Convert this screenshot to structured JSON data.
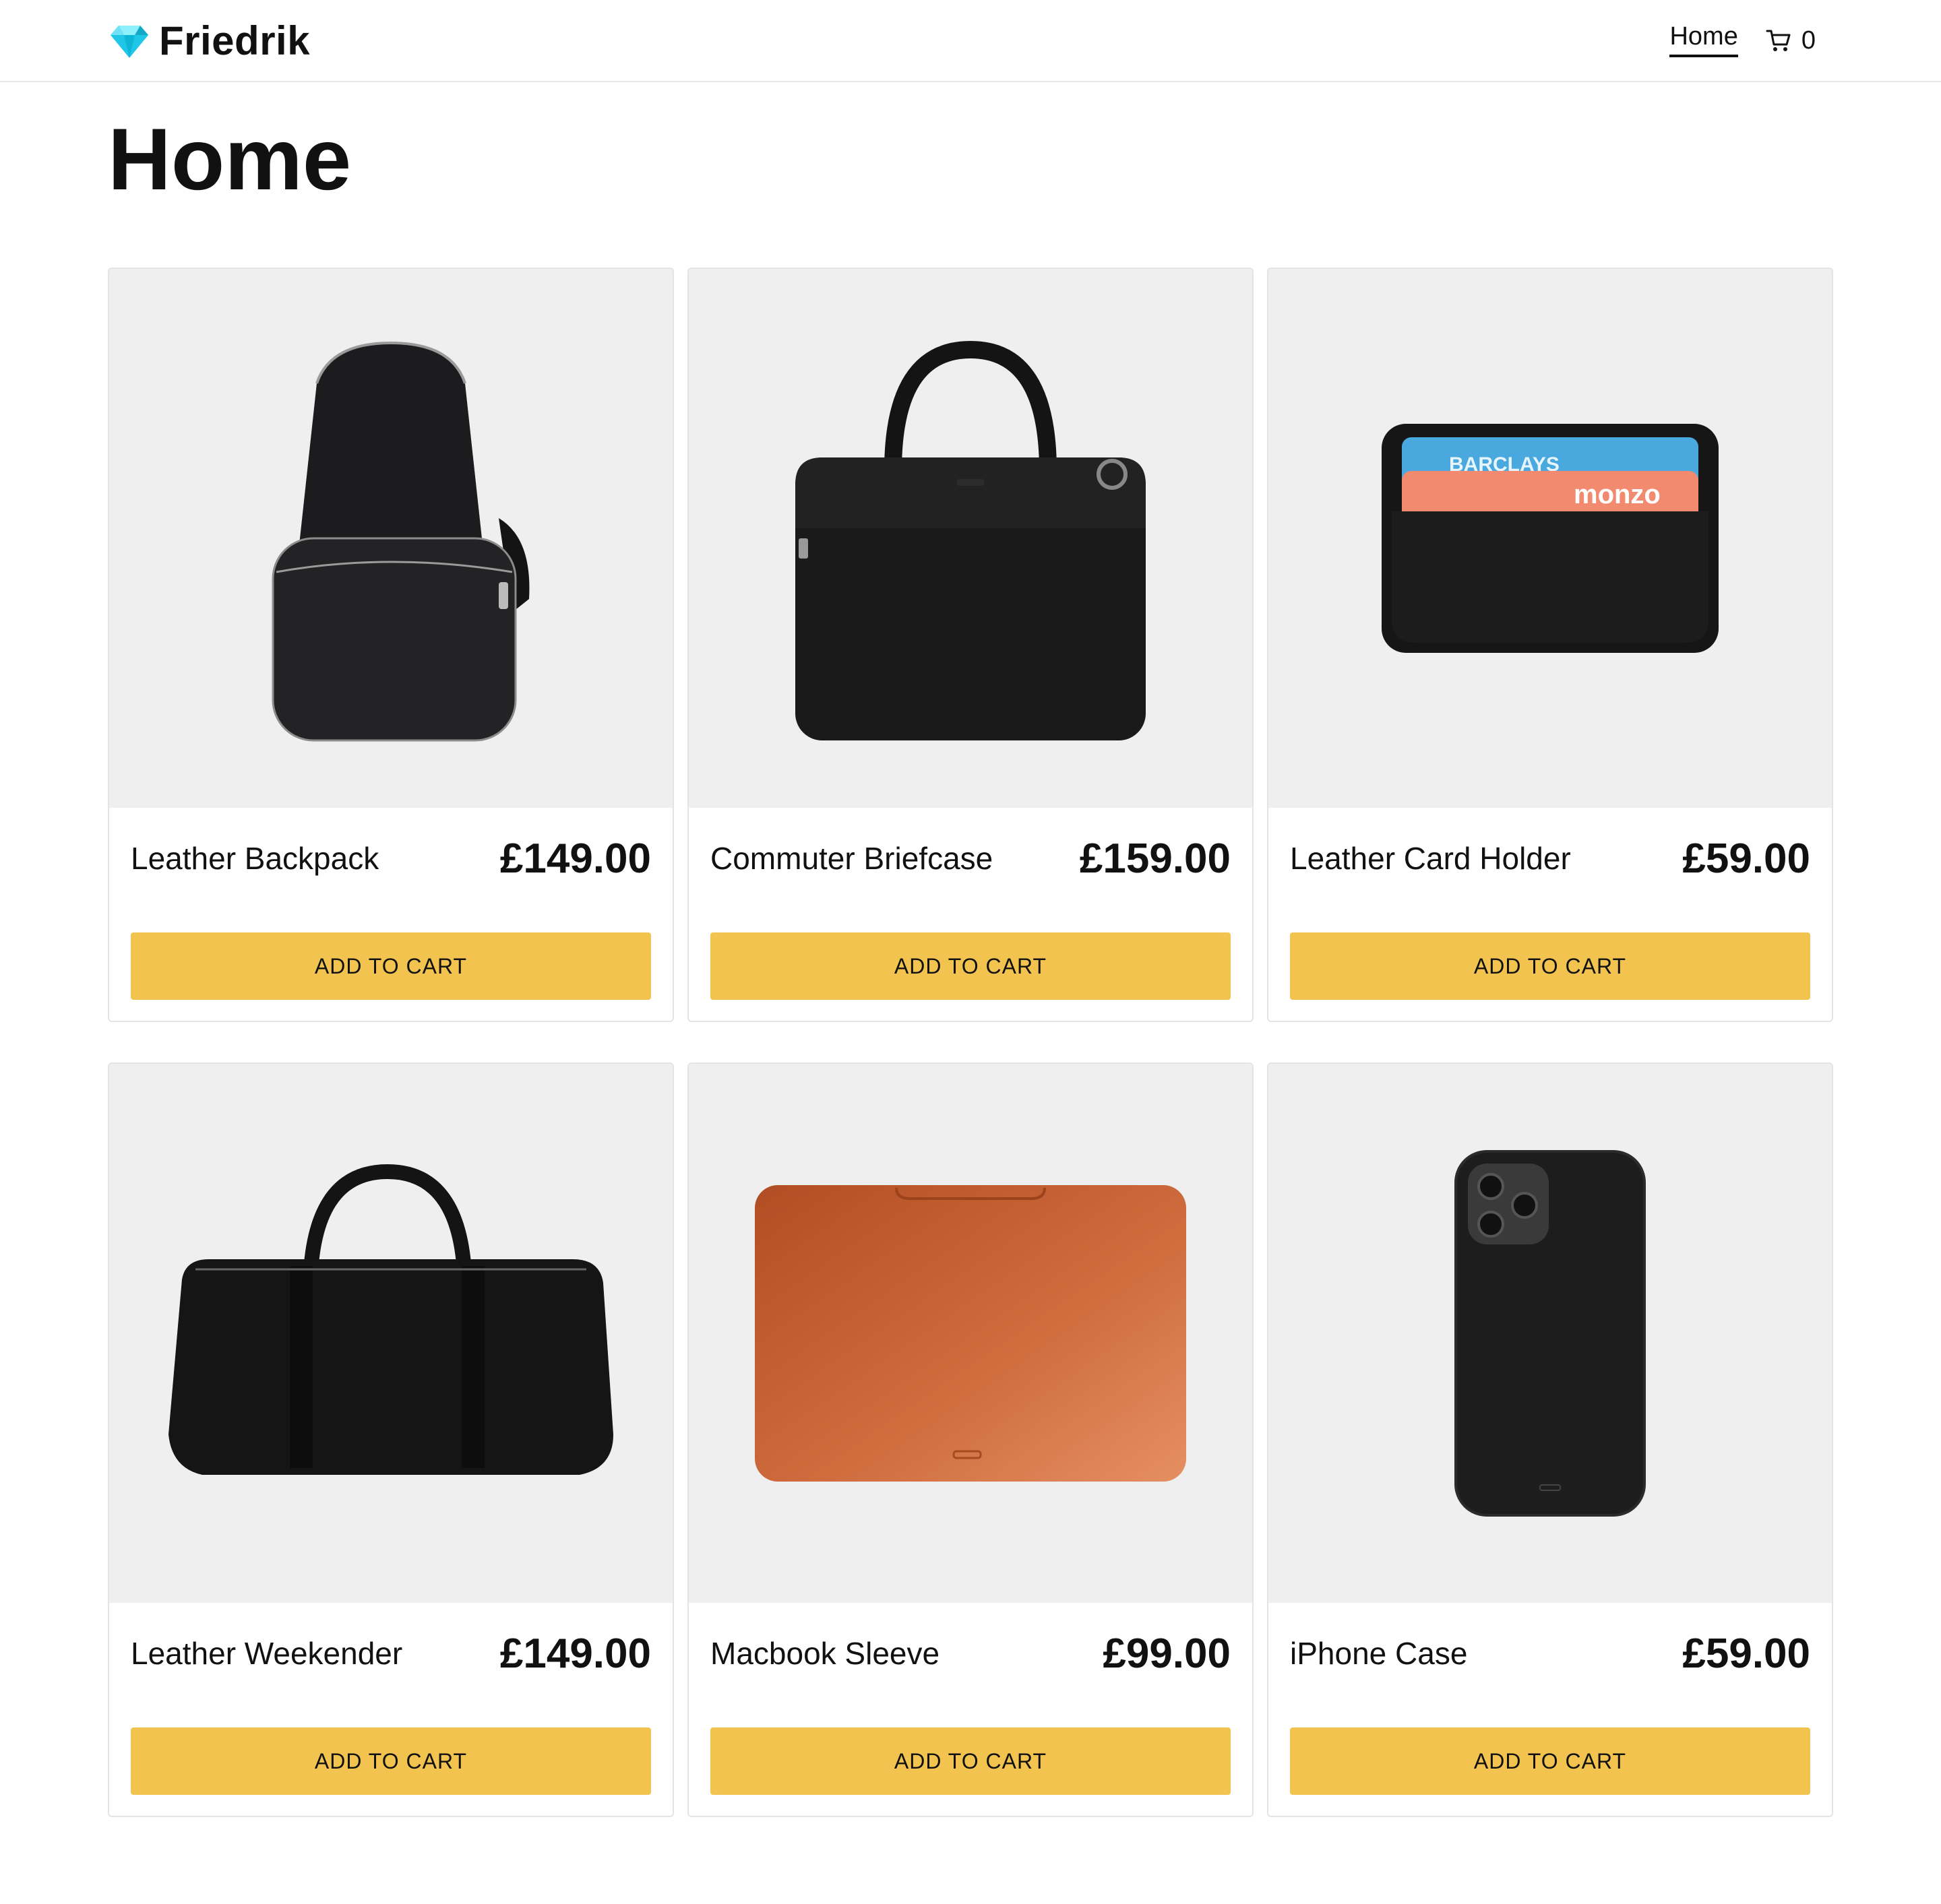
{
  "header": {
    "brand": "Friedrik",
    "nav_home": "Home",
    "cart_count": "0",
    "brand_color": "#1fc7e6"
  },
  "page": {
    "title": "Home"
  },
  "products": [
    {
      "name": "Leather Backpack",
      "price": "£149.00",
      "button": "ADD TO CART",
      "image": "backpack"
    },
    {
      "name": "Commuter Briefcase",
      "price": "£159.00",
      "button": "ADD TO CART",
      "image": "briefcase"
    },
    {
      "name": "Leather Card Holder",
      "price": "£59.00",
      "button": "ADD TO CART",
      "image": "card-holder",
      "card_labels": [
        "BARCLAYS",
        "monzo"
      ]
    },
    {
      "name": "Leather Weekender",
      "price": "£149.00",
      "button": "ADD TO CART",
      "image": "weekender"
    },
    {
      "name": "Macbook Sleeve",
      "price": "£99.00",
      "button": "ADD TO CART",
      "image": "laptop-sleeve",
      "color": "#c8612f"
    },
    {
      "name": "iPhone Case",
      "price": "£59.00",
      "button": "ADD TO CART",
      "image": "phone-case"
    }
  ],
  "colors": {
    "button": "#f2c44f",
    "photo_bg": "#efefef"
  }
}
